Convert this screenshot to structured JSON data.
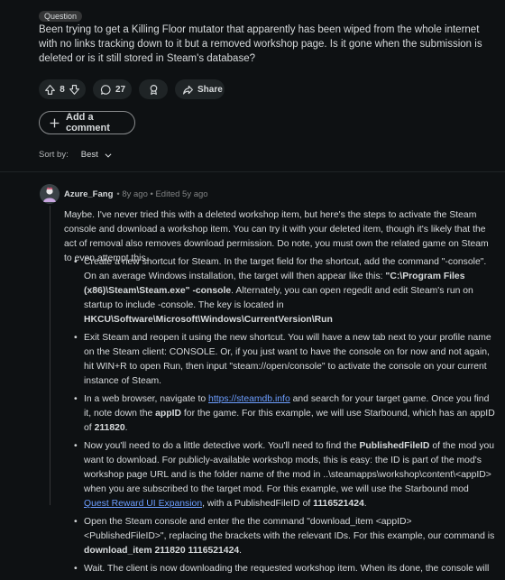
{
  "post": {
    "flair": "Question",
    "body": "Been trying to get a Killing Floor mutator that apparently has been wiped from the whole internet with no links tracking down to it but a removed workshop page. Is it gone when the submission is deleted or is it still stored in Steam's database?",
    "votes": "8",
    "comment_count": "27",
    "share_label": "Share",
    "add_comment_label": "Add a comment",
    "sort_label": "Sort by:",
    "sort_value": "Best"
  },
  "comment": {
    "author": "Azure_Fang",
    "meta": "• 8y ago • Edited 5y ago",
    "intro": "Maybe. I've never tried this with a deleted workshop item, but here's the steps to activate the Steam console and download a workshop item. You can try it with your deleted item, though it's likely that the act of removal also removes download permission. Do note, you must own the related game on Steam to even attempt this.",
    "b1": {
      "t1": "Create a new shortcut for Steam. In the target field for the shortcut, add the command \"-console\". On an average Windows installation, the target will then appear like this: ",
      "b1": "\"C:\\Program Files (x86)\\Steam\\Steam.exe\" -console",
      "t2": ". Alternately, you can open regedit and edit Steam's run on startup to include -console. The key is located in ",
      "b2": "HKCU\\Software\\Microsoft\\Windows\\CurrentVersion\\Run"
    },
    "b2": "Exit Steam and reopen it using the new shortcut. You will have a new tab next to your profile name on the Steam client: CONSOLE. Or, if you just want to have the console on for now and not again, hit WIN+R to open Run, then input \"steam://open/console\" to activate the console on your current instance of Steam.",
    "b3": {
      "t1": "In a web browser, navigate to ",
      "link": "https://steamdb.info",
      "t2": " and search for your target game. Once you find it, note down the ",
      "b1": "appID",
      "t3": " for the game. For this example, we will use Starbound, which has an appID of ",
      "b2": "211820",
      "t4": "."
    },
    "b4": {
      "t1": "Now you'll need to do a little detective work. You'll need to find the ",
      "b1": "PublishedFileID",
      "t2": " of the mod you want to download. For publicly-available workshop mods, this is easy: the ID is part of the mod's workshop page URL and is the folder name of the mod in ..\\steamapps\\workshop\\content\\<appID> when you are subscribed to the target mod. For this example, we will use the Starbound mod ",
      "link": "Quest Reward UI Expansion",
      "t3": ", with a PublishedFileID of ",
      "b2": "1116521424",
      "t4": "."
    },
    "b5": {
      "t1": "Open the Steam console and enter the the command \"download_item <appID> <PublishedFileID>\", replacing the brackets with the relevant IDs. For this example, our command is ",
      "b1": "download_item 211820 1116521424",
      "t2": "."
    },
    "b6": "Wait. The client is now downloading the requested workshop item. When its done, the console will"
  },
  "colors": {
    "background": "#0e1113",
    "pill": "#1f2426",
    "link": "#6d9eff",
    "text": "#d7dadc",
    "meta": "#818384"
  },
  "icons": [
    "upvote-icon",
    "downvote-icon",
    "comment-icon",
    "award-icon",
    "share-icon",
    "plus-icon",
    "chevron-down-icon"
  ]
}
